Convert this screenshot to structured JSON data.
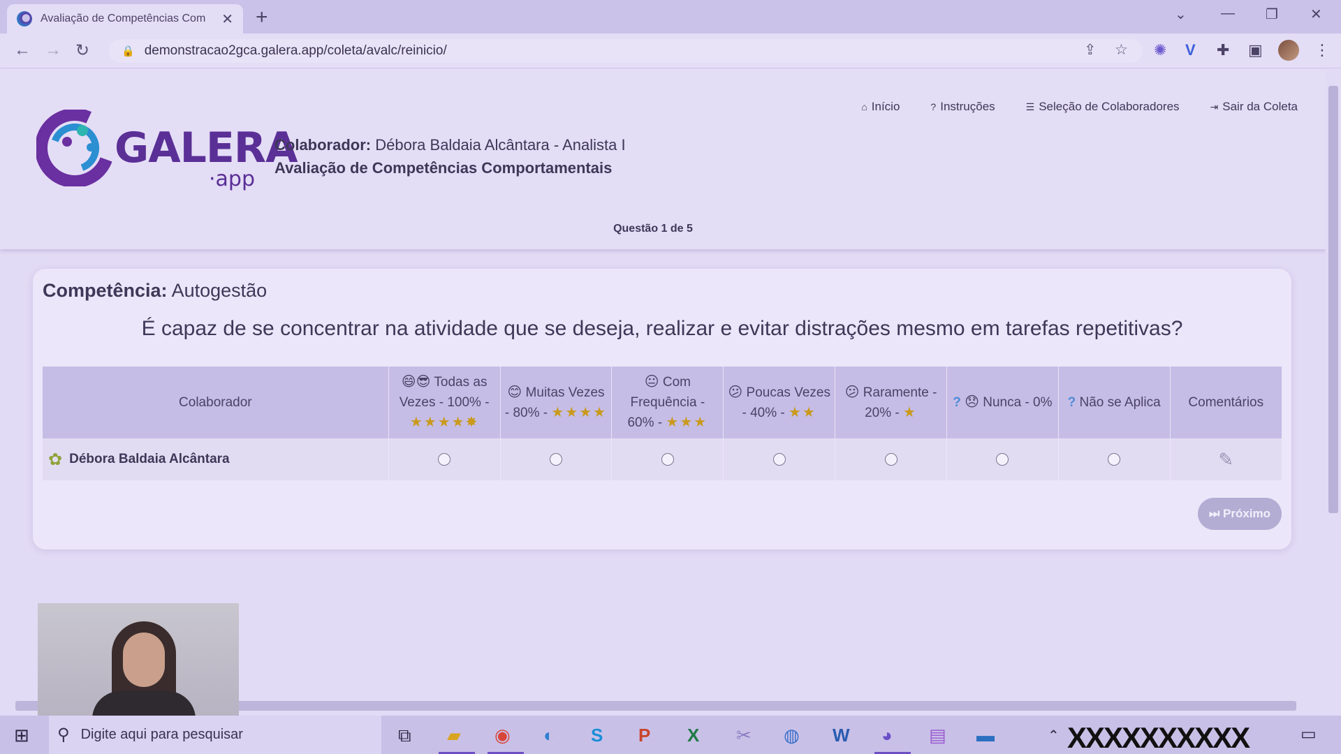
{
  "browser": {
    "tab_title": "Avaliação de Competências Com",
    "tab_close": "✕",
    "new_tab": "+",
    "url": "demonstracao2gca.galera.app/coleta/avalc/reinicio/",
    "window_controls": {
      "dropdown": "⌄",
      "minimize": "—",
      "restore": "❐",
      "close": "✕"
    },
    "nav": {
      "back": "←",
      "forward": "→",
      "reload": "↻",
      "lock": "🔒"
    },
    "icons": [
      "share-icon",
      "star-icon",
      "extension-icon",
      "vimeo-icon",
      "puzzle-icon",
      "sidebar-icon",
      "menu-icon"
    ]
  },
  "header": {
    "logo_text": "GALERA",
    "logo_sub": "·app",
    "colaborador_label": "Colaborador:",
    "colaborador_value": "Débora Baldaia Alcântara - Analista I",
    "evaluation_title": "Avaliação de Competências Comportamentais",
    "question_counter": "Questão 1 de 5",
    "nav": [
      {
        "icon": "⌂",
        "label": "Início"
      },
      {
        "icon": "?",
        "label": "Instruções"
      },
      {
        "icon": "☰",
        "label": "Seleção de Colaboradores"
      },
      {
        "icon": "⇥",
        "label": "Sair da Coleta"
      }
    ]
  },
  "card": {
    "competencia_label": "Competência:",
    "competencia_value": "Autogestão",
    "question": "É capaz de se concentrar na atividade que se deseja, realizar e evitar distrações mesmo em tarefas repetitivas?",
    "columns": {
      "colaborador": "Colaborador",
      "opt1": {
        "emoji": "😄😎",
        "label": "Todas as Vezes - 100% -",
        "stars": "★★★★✸"
      },
      "opt2": {
        "emoji": "😊",
        "label": "Muitas Vezes - 80% -",
        "stars": "★★★★"
      },
      "opt3": {
        "emoji": "😐",
        "label": "Com Frequência - 60% -",
        "stars": "★★★"
      },
      "opt4": {
        "emoji": "😕",
        "label": "Poucas Vezes - 40% -",
        "stars": "★★"
      },
      "opt5": {
        "emoji": "😕",
        "label": "Raramente - 20% -",
        "stars": "★"
      },
      "opt6": {
        "qmark": "?",
        "emoji": "😞",
        "label": "Nunca - 0%"
      },
      "opt7": {
        "qmark": "?",
        "label": "Não se Aplica"
      },
      "comentarios": "Comentários"
    },
    "rows": [
      {
        "name": "Débora Baldaia Alcântara",
        "comment_icon": "✎"
      }
    ],
    "next_button": "⏭ Próximo"
  },
  "taskbar": {
    "search_placeholder": "Digite aqui para pesquisar",
    "tray_mask": "XXXXXXXXXX"
  },
  "colors": {
    "accent": "#5a2f96",
    "page_bg": "#e2dbf5",
    "table_header_bg": "#c6bde6",
    "star": "#c99a1c",
    "next_button_bg": "#b3add4"
  }
}
